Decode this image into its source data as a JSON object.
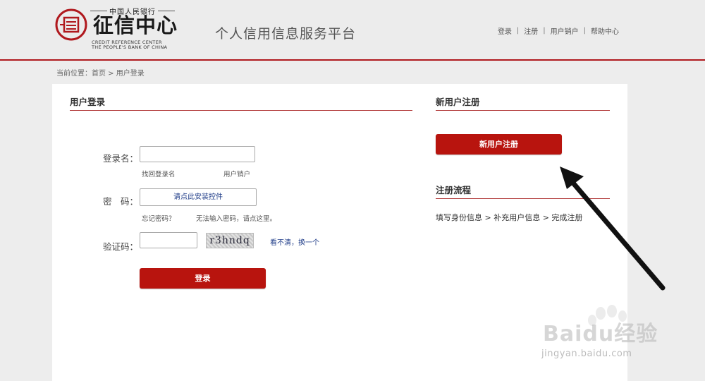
{
  "header": {
    "logo_top": "中国人民银行",
    "logo_main": "征信中心",
    "logo_en_line1": "CREDIT REFERENCE CENTER",
    "logo_en_line2": "THE PEOPLE'S BANK OF CHINA",
    "platform_title": "个人信用信息服务平台",
    "nav": [
      "登录",
      "注册",
      "用户销户",
      "帮助中心"
    ],
    "nav_separator": "|"
  },
  "breadcrumb": "当前位置：首页 > 用户登录",
  "login": {
    "title": "用户登录",
    "username_label": "登录名：",
    "find_username": "找回登录名",
    "cancel_account": "用户销户",
    "password_label": "密　码：",
    "install_control": "请点此安装控件",
    "forgot_password": "忘记密码？",
    "cannot_input": "无法输入密码，请点这里。",
    "captcha_label": "验证码：",
    "captcha_text": "r3hndq",
    "refresh_captcha": "看不清，换一个",
    "login_button": "登录"
  },
  "register": {
    "title": "新用户注册",
    "button": "新用户注册",
    "flow_title": "注册流程",
    "flow_steps": "填写身份信息 > 补充用户信息 > 完成注册"
  },
  "watermark": {
    "text": "Baidu经验",
    "url": "jingyan.baidu.com"
  },
  "colors": {
    "accent": "#b8140e",
    "header_line": "#b0191e",
    "link": "#1f3c88"
  }
}
